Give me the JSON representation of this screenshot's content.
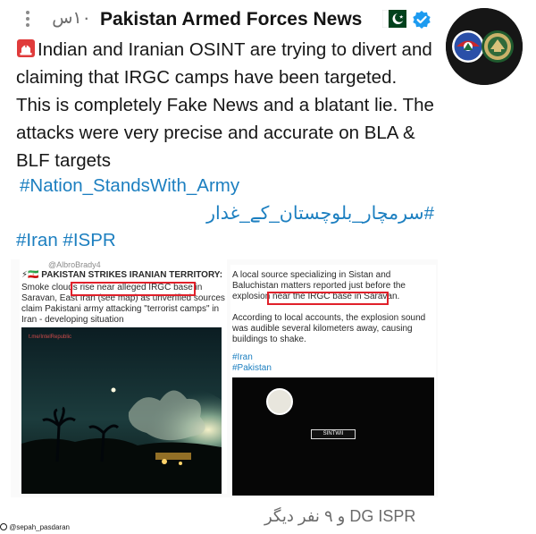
{
  "header": {
    "menu_icon": "vertical-dots-icon",
    "time": "۱۰س",
    "author_name": "Pakistan Armed Forces News",
    "flag_icon": "pakistan-flag-icon",
    "verified_icon": "verified-badge-icon",
    "avatar_icon": "emblems-avatar"
  },
  "tweet": {
    "siren_icon": "police-siren-icon",
    "text": "Indian and Iranian OSINT are trying to divert and claiming that IRGC camps have been targeted. This is completely Fake News and a blatant lie. The attacks were very precise and accurate on BLA & BLF targets",
    "hashtag_1": "#Nation_StandsWith_Army",
    "hashtag_2": "#سرمچار_بلوچستان_کے_غدار",
    "hashtag_3": "#Iran #ISPR"
  },
  "embed": {
    "left_card": {
      "handle": "@AlbroBrady4",
      "headline_prefix": "⚡🇮🇷",
      "headline": "PAKISTAN STRIKES IRANIAN TERRITORY:",
      "body": "Smoke clouds rise near alleged IRGC base in Saravan, East Iran (see map) as unverified sources claim Pakistani army attacking \"terrorist camps\" in Iran - developing situation",
      "video_watermark": "t.me/IntelRepublic"
    },
    "right_card": {
      "body_1": "A local source specializing in Sistan and Baluchistan matters reported just before the explosion near the IRGC base in Saravan.",
      "body_2": "According to local accounts, the explosion sound was audible several kilometers away, causing buildings to shake.",
      "tag_1": "#Iran",
      "tag_2": "#Pakistan",
      "video_caption": "SINTWII"
    },
    "source_handle": "@sepah_pasdaran"
  },
  "footer": {
    "retweet_text": "DG ISPR و ۹ نفر دیگر"
  },
  "colors": {
    "link": "#1c7fc0",
    "highlight_box": "#e0202a",
    "text": "#161616",
    "muted": "#6b6b6b"
  }
}
